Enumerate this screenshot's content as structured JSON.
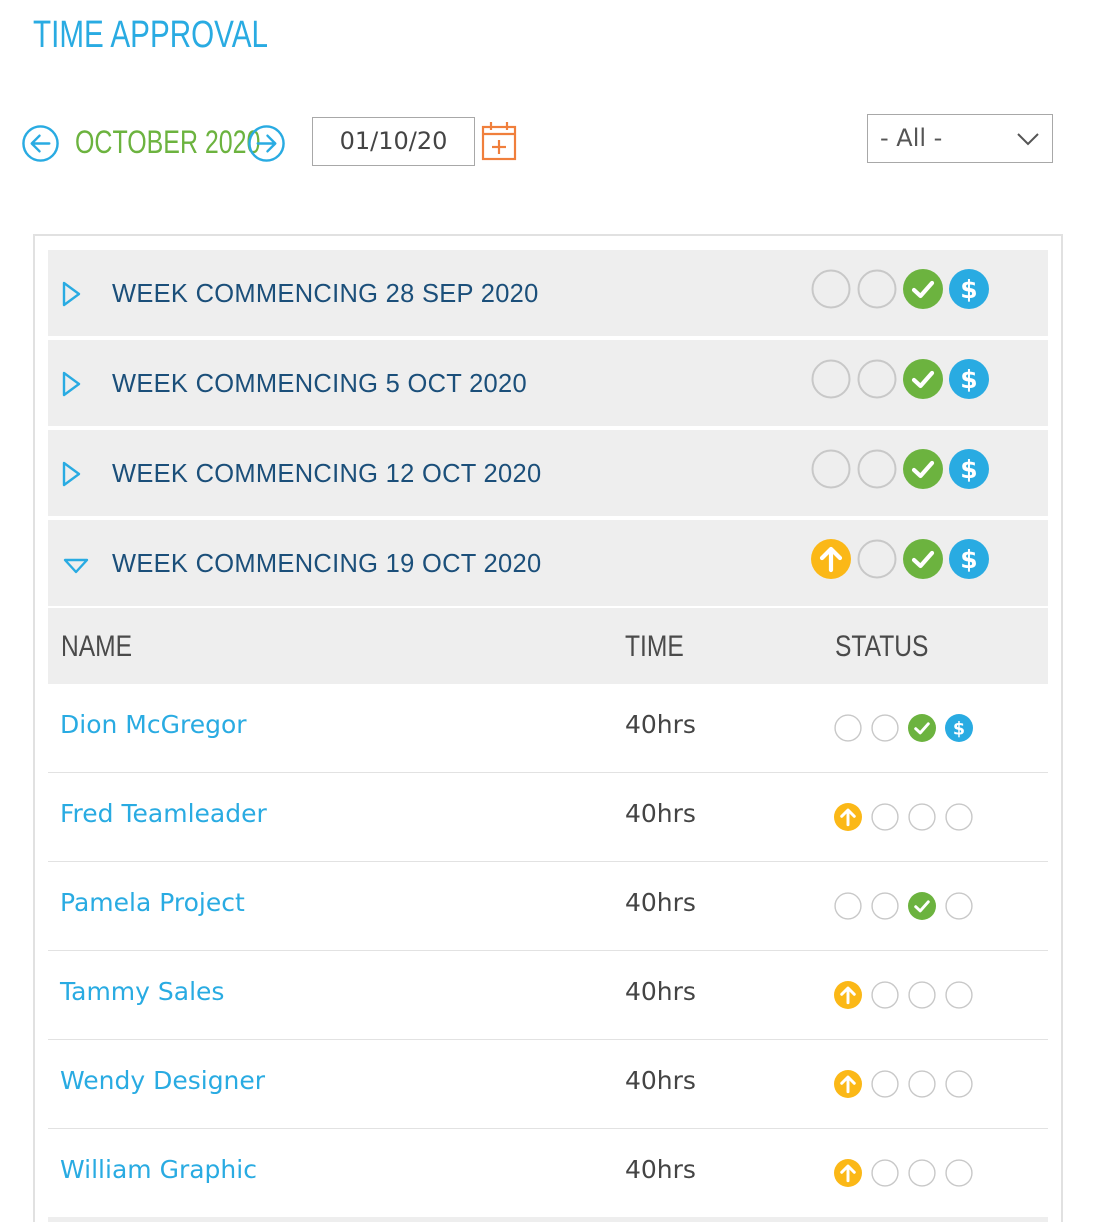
{
  "header": {
    "title": "TIME APPROVAL"
  },
  "nav": {
    "month": "OCTOBER 2020",
    "date_value": "01/10/20",
    "filter_value": "- All -"
  },
  "colors": {
    "accent_blue": "#29abe2",
    "month_green": "#6cb33f",
    "approved_green": "#6cb33f",
    "pending_yellow": "#fbb817",
    "calendar_orange": "#f07f3c",
    "week_text": "#1b4f7a"
  },
  "weeks": [
    {
      "label": "WEEK COMMENCING 28 SEP 2020",
      "expanded": false,
      "status": [
        "empty",
        "empty",
        "approved-check",
        "paid-dollar"
      ]
    },
    {
      "label": "WEEK COMMENCING 5 OCT 2020",
      "expanded": false,
      "status": [
        "empty",
        "empty",
        "approved-check",
        "paid-dollar"
      ]
    },
    {
      "label": "WEEK COMMENCING 12 OCT 2020",
      "expanded": false,
      "status": [
        "empty",
        "empty",
        "approved-check",
        "paid-dollar"
      ]
    },
    {
      "label": "WEEK COMMENCING 19 OCT 2020",
      "expanded": true,
      "status": [
        "submitted-arrow",
        "empty",
        "approved-check",
        "paid-dollar"
      ]
    }
  ],
  "table": {
    "headers": {
      "name": "NAME",
      "time": "TIME",
      "status": "STATUS"
    },
    "rows": [
      {
        "name": "Dion McGregor",
        "time": "40hrs",
        "status": [
          "empty",
          "empty",
          "approved-check",
          "paid-dollar"
        ]
      },
      {
        "name": "Fred Teamleader",
        "time": "40hrs",
        "status": [
          "submitted-arrow",
          "empty",
          "empty",
          "empty"
        ]
      },
      {
        "name": "Pamela Project",
        "time": "40hrs",
        "status": [
          "empty",
          "empty",
          "approved-check",
          "empty"
        ]
      },
      {
        "name": "Tammy Sales",
        "time": "40hrs",
        "status": [
          "submitted-arrow",
          "empty",
          "empty",
          "empty"
        ]
      },
      {
        "name": "Wendy Designer",
        "time": "40hrs",
        "status": [
          "submitted-arrow",
          "empty",
          "empty",
          "empty"
        ]
      },
      {
        "name": "William Graphic",
        "time": "40hrs",
        "status": [
          "submitted-arrow",
          "empty",
          "empty",
          "empty"
        ]
      }
    ]
  },
  "icons": {
    "prev": "arrow-left-circle-icon",
    "next": "arrow-right-circle-icon",
    "calendar": "calendar-add-icon",
    "dropdown": "chevron-down-icon",
    "collapsed": "triangle-right-icon",
    "expanded": "triangle-down-icon"
  }
}
